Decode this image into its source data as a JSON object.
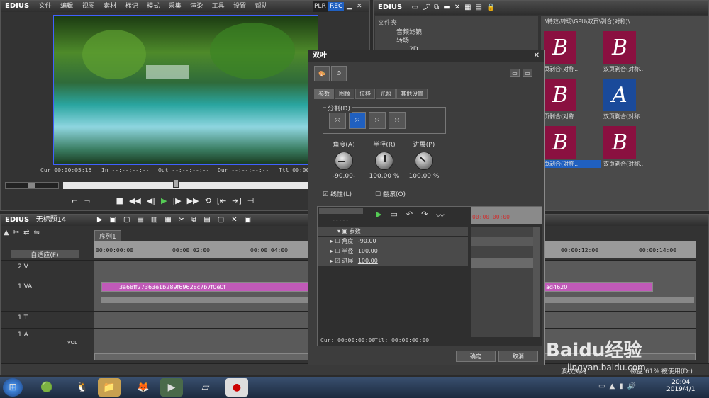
{
  "app": {
    "name": "EDIUS",
    "menu": [
      "文件",
      "编辑",
      "视图",
      "素材",
      "标记",
      "模式",
      "采集",
      "渲染",
      "工具",
      "设置",
      "帮助"
    ],
    "plr": "PLR",
    "rec": "REC"
  },
  "preview": {
    "cur_label": "Cur",
    "cur": "00:00:05:16",
    "in_label": "In",
    "in": "--:--:--:--",
    "out_label": "Out",
    "out": "--:--:--:--",
    "dur_label": "Dur",
    "dur": "--:--:--:--",
    "ttl_label": "Ttl",
    "ttl": "00:00:"
  },
  "bin": {
    "title": "EDIUS",
    "folder_label": "文件夹",
    "tree": [
      "音频滤镜",
      "转场",
      "2D"
    ],
    "path": "\\特效\\转场\\GPU\\双页\\剥合(对称)\\",
    "items": [
      {
        "letter": "B",
        "label": "页剥合(对称..."
      },
      {
        "letter": "B",
        "label": "双页剥合(对称..."
      },
      {
        "letter": "B",
        "label": "页剥合(对称..."
      },
      {
        "letter": "A",
        "label": "双页剥合(对称..."
      },
      {
        "letter": "B",
        "label": "页剥合(对称..."
      },
      {
        "letter": "B",
        "label": "双页剥合(对称..."
      }
    ]
  },
  "timeline": {
    "title": "EDIUS",
    "project": "无标题14",
    "sequence_tab": "序列1",
    "ruler": [
      "00:00:00:00",
      "00:00:02:00",
      "00:00:04:00",
      "00:00:12:00",
      "00:00:14:00"
    ],
    "auto_label": "自适应(F)",
    "tracks": [
      "2 V",
      "1 VA",
      "1 T",
      "1 A"
    ],
    "vol": "VOL",
    "clip_name": "3a68ff27363e1b289f69628c7b7f0e0f",
    "clip_name_tail": "ad4620"
  },
  "dialog": {
    "title": "双叶",
    "tabs": [
      "参数",
      "图像",
      "位移",
      "光照",
      "其他设置"
    ],
    "split_label": "分割(D)",
    "knobs": [
      {
        "label": "角度(A)",
        "value": "-90.00-"
      },
      {
        "label": "半径(R)",
        "value": "100.00 %"
      },
      {
        "label": "进展(P)",
        "value": "100.00 %"
      }
    ],
    "linear_label": "线性(L)",
    "flip_label": "翻滚(O)",
    "params": [
      {
        "name": "参数",
        "value": ""
      },
      {
        "name": "角度",
        "value": "-90.00"
      },
      {
        "name": "半径",
        "value": "100.00"
      },
      {
        "name": "进展",
        "value": "100.00"
      }
    ],
    "kf_dashes": "-----",
    "kf_time": "00:00:00:00",
    "cur_text": "Cur: 00:00:00:00",
    "ttl_text": "Ttl: 00:00:00:00",
    "ok": "确定",
    "cancel": "取消"
  },
  "status": {
    "left": "波纹关闭",
    "disk": "磁盘:61% 被使用(D:)"
  },
  "taskbar": {
    "time": "20:04",
    "date": "2019/4/1"
  },
  "watermark": {
    "brand": "Baidu经验",
    "url": "jingyan.baidu.com"
  }
}
